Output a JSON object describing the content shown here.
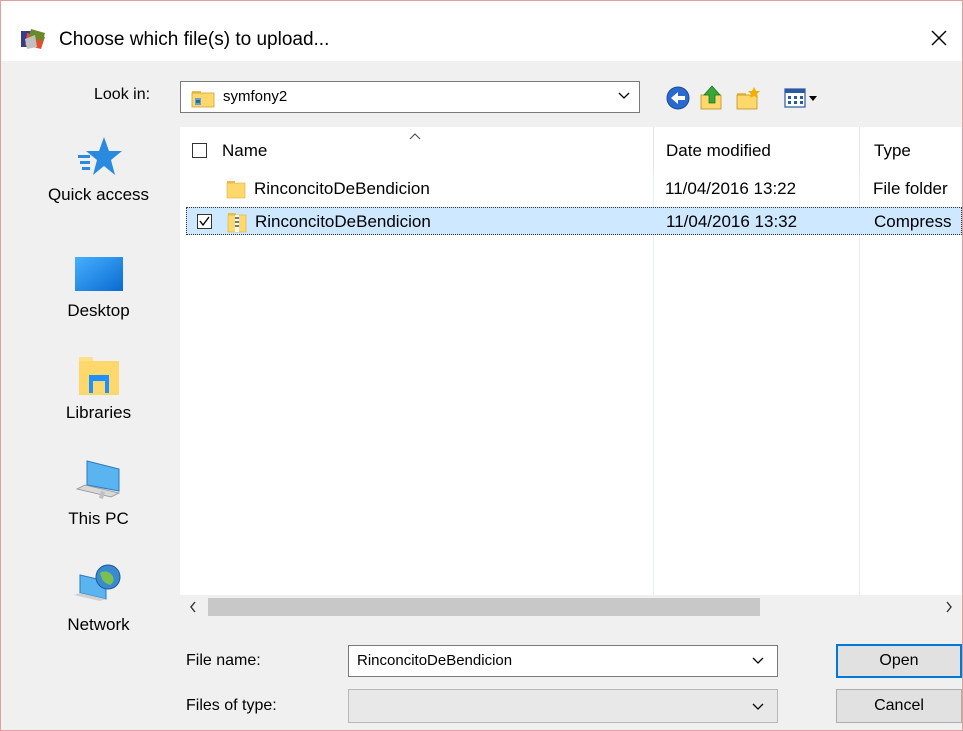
{
  "window": {
    "title": "Choose which file(s) to upload...",
    "close_glyph": "✕",
    "close_icon": "close-icon"
  },
  "lookin": {
    "label": "Look in:",
    "value": "symfony2",
    "icon": "folder-icon"
  },
  "toolbar": {
    "icons": [
      "back-icon",
      "up-folder-icon",
      "new-folder-icon",
      "view-menu-icon"
    ]
  },
  "places": [
    {
      "label": "Quick access",
      "icon": "star-icon"
    },
    {
      "label": "Desktop",
      "icon": "desktop-icon"
    },
    {
      "label": "Libraries",
      "icon": "libraries-icon"
    },
    {
      "label": "This PC",
      "icon": "computer-icon"
    },
    {
      "label": "Network",
      "icon": "network-icon"
    }
  ],
  "columns": {
    "name": "Name",
    "date": "Date modified",
    "type": "Type"
  },
  "files": [
    {
      "name": "RinconcitoDeBendicion",
      "date": "11/04/2016 13:22",
      "type": "File folder",
      "icon": "folder-icon",
      "selected": false
    },
    {
      "name": "RinconcitoDeBendicion",
      "date": "11/04/2016 13:32",
      "type": "Compress",
      "icon": "zip-folder-icon",
      "selected": true
    }
  ],
  "file_name": {
    "label": "File name:",
    "value": "RinconcitoDeBendicion"
  },
  "file_type": {
    "label": "Files of type:",
    "value": ""
  },
  "buttons": {
    "open": "Open",
    "cancel": "Cancel"
  },
  "colors": {
    "selection": "#cde8ff",
    "accent": "#0078d7",
    "folder": "#ffd86b"
  }
}
